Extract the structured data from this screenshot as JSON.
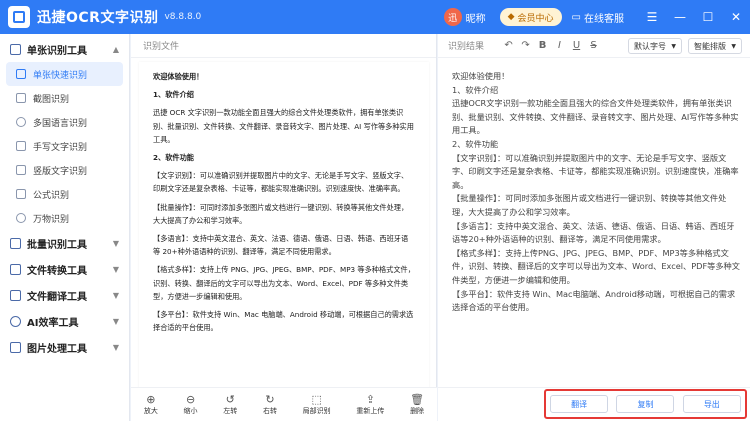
{
  "app": {
    "title": "迅捷OCR文字识别",
    "version": "v8.8.8.0"
  },
  "header": {
    "avatar_text": "迅",
    "nickname": "昵称",
    "vip_label": "会员中心",
    "service_label": "在线客服"
  },
  "window_controls": [
    "☰",
    "—",
    "☐",
    "✕"
  ],
  "sidebar": {
    "groups": [
      {
        "label": "单张识别工具",
        "expanded": true,
        "items": [
          {
            "label": "单张快速识别",
            "active": true
          },
          {
            "label": "截图识别"
          },
          {
            "label": "多国语言识别"
          },
          {
            "label": "手写文字识别"
          },
          {
            "label": "竖版文字识别"
          },
          {
            "label": "公式识别"
          },
          {
            "label": "万物识别"
          }
        ]
      },
      {
        "label": "批量识别工具"
      },
      {
        "label": "文件转换工具"
      },
      {
        "label": "文件翻译工具"
      },
      {
        "label": "AI效率工具"
      },
      {
        "label": "图片处理工具"
      }
    ]
  },
  "left_panel": {
    "title": "识别文件",
    "doc": [
      {
        "text": "欢迎体验使用！",
        "heading": true
      },
      {
        "text": "1、软件介绍",
        "heading": true
      },
      {
        "text": "迅捷 OCR 文字识别一款功能全面且强大的综合文件处理类软件，拥有单张类识别、批量识别、文件转换、文件翻译、录音转文字、图片处理、AI 写作等多种实用工具。"
      },
      {
        "text": "2、软件功能",
        "heading": true
      },
      {
        "text": "【文字识别】：可以准确识别并提取图片中的文字、无论是手写文字、竖版文字、印刷文字还是复杂表格、卡证等，都能实现准确识别。识别速度快、准确率高。"
      },
      {
        "text": "【批量操作】：可同时添加多张图片或文档进行一键识别、转换等其他文件处理，大大提高了办公和学习效率。"
      },
      {
        "text": "【多语言】：支持中英文混合、英文、法语、德语、俄语、日语、韩语、西班牙语等 20+种外语语种的识别、翻译等，满足不同使用需求。"
      },
      {
        "text": "【格式多样】：支持上传 PNG、JPG、JPEG、BMP、PDF、MP3 等多种格式文件，识别、转换、翻译后的文字可以导出为文本、Word、Excel、PDF 等多种文件类型，方便进一步编辑和使用。"
      },
      {
        "text": "【多平台】：软件支持 Win、Mac 电脑端、Android 移动端，可根据自己的需求选择合适的平台使用。"
      }
    ],
    "tools": [
      {
        "icon": "⊕",
        "label": "放大"
      },
      {
        "icon": "⊖",
        "label": "缩小"
      },
      {
        "icon": "↺",
        "label": "左转"
      },
      {
        "icon": "↻",
        "label": "右转"
      },
      {
        "icon": "⬚",
        "label": "局部识别"
      },
      {
        "icon": "⇪",
        "label": "重新上传"
      },
      {
        "icon": "🗑",
        "label": "删除"
      }
    ]
  },
  "right_panel": {
    "title": "识别结果",
    "font_select": "默认字号",
    "layout_select": "智能排版",
    "result": [
      "欢迎体验使用！",
      "1、软件介绍",
      "迅捷OCR文字识别一款功能全面且强大的综合文件处理类软件，拥有单张类识别、批量识别、文件转换、文件翻译、录音转文字、图片处理、AI写作等多种实用工具。",
      "2、软件功能",
      "【文字识别】：可以准确识别并提取图片中的文字、无论是手写文字、竖版文字、印刷文字还是复杂表格、卡证等，都能实现准确识别。识别速度快，准确率高。",
      "【批量操作】：可同时添加多张图片或文档进行一键识别、转换等其他文件处理，大大提高了办公和学习效率。",
      "【多语言】：支持中英文混合、英文、法语、德语、俄语、日语、韩语、西班牙语等20+种外语语种的识别、翻译等，满足不同使用需求。",
      "【格式多样】：支持上传PNG、JPG、JPEG、BMP、PDF、MP3等多种格式文件，识别、转换、翻译后的文字可以导出为文本、Word、Excel、PDF等多种文件类型，方便进一步编辑和使用。",
      "【多平台】：软件支持 Win、Mac电脑端、Android移动端，可根据自己的需求选择合适的平台使用。"
    ],
    "actions": {
      "translate": "翻译",
      "copy": "复制",
      "export": "导出"
    }
  }
}
